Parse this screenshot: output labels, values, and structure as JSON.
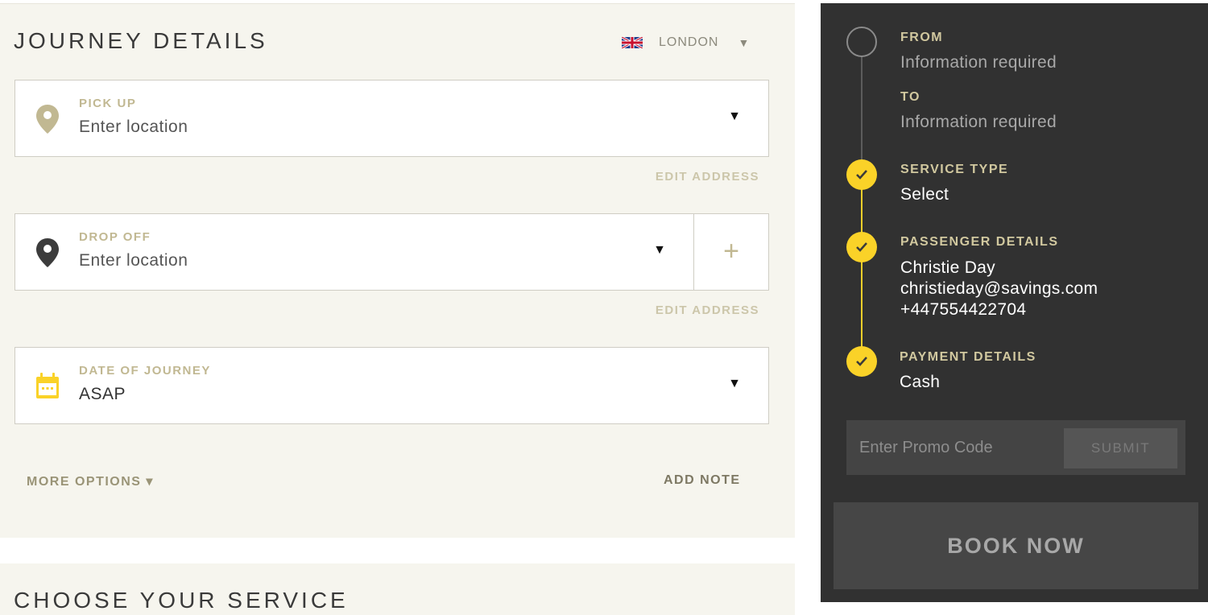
{
  "journey": {
    "title": "JOURNEY DETAILS",
    "city": "LONDON",
    "pickup": {
      "label": "PICK UP",
      "value": "Enter location"
    },
    "pickup_edit": "EDIT ADDRESS",
    "dropoff": {
      "label": "DROP OFF",
      "value": "Enter location",
      "add_symbol": "+"
    },
    "dropoff_edit": "EDIT ADDRESS",
    "date": {
      "label": "DATE OF JOURNEY",
      "value": "ASAP"
    },
    "more_options": "MORE OPTIONS ▾",
    "add_note": "ADD NOTE"
  },
  "service": {
    "title": "CHOOSE YOUR SERVICE"
  },
  "summary": {
    "from": {
      "label": "FROM",
      "value": "Information required"
    },
    "to": {
      "label": "TO",
      "value": "Information required"
    },
    "service_type": {
      "label": "SERVICE TYPE",
      "value": "Select"
    },
    "passenger": {
      "label": "PASSENGER DETAILS",
      "name": "Christie Day",
      "email": "christieday@savings.com",
      "phone": "+447554422704"
    },
    "payment": {
      "label": "PAYMENT DETAILS",
      "value": "Cash"
    },
    "promo": {
      "placeholder": "Enter Promo Code",
      "submit": "SUBMIT"
    },
    "book_now": "BOOK NOW"
  },
  "icons": {
    "pickup": "location-pin-icon",
    "dropoff": "location-pin-icon",
    "date": "calendar-icon",
    "check": "check-icon",
    "flag": "uk-flag-icon"
  },
  "colors": {
    "accent_gold": "#c1b892",
    "check_yellow": "#fad228",
    "panel_dark": "#313131",
    "panel_light": "#f6f5ee"
  }
}
